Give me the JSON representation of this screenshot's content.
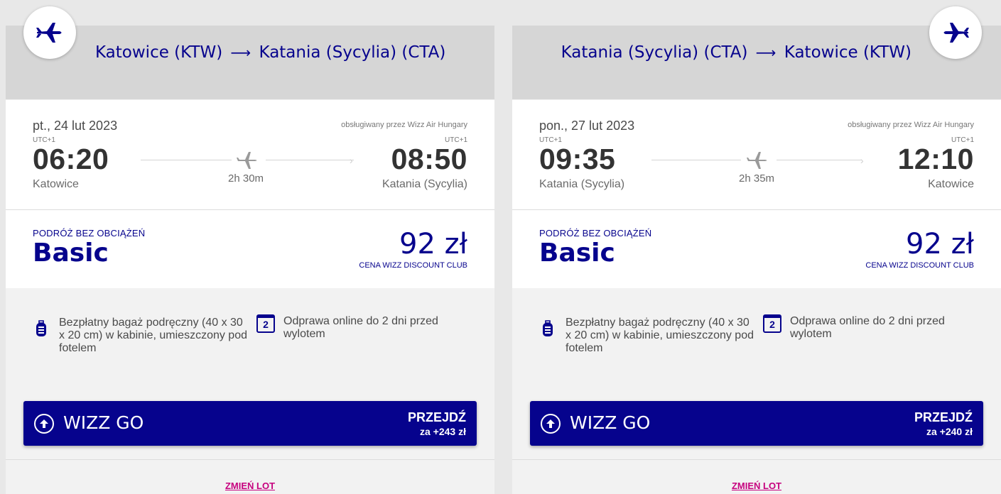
{
  "colors": {
    "brand_blue": "#06038d",
    "link_pink": "#c6007e"
  },
  "flights": [
    {
      "route_from": "Katowice (KTW)",
      "route_arrow": "⟶",
      "route_to": "Katania (Sycylia) (CTA)",
      "date": "pt., 24 lut 2023",
      "operated_by": "obsługiwany przez Wizz Air Hungary",
      "dep_utc": "UTC+1",
      "dep_time": "06:20",
      "dep_city": "Katowice",
      "arr_utc": "UTC+1",
      "arr_time": "08:50",
      "arr_city": "Katania (Sycylia)",
      "duration": "2h 30m",
      "fare_kicker": "PODRÓŻ BEZ OBCIĄŻEŃ",
      "fare_name": "Basic",
      "price": "92 zł",
      "price_note": "CENA WIZZ DISCOUNT CLUB",
      "benefit_bag": "Bezpłatny bagaż podręczny (40 x 30 x 20 cm) w kabinie, umieszczony pod fotelem",
      "benefit_checkin": "Odprawa online do 2 dni przed wylotem",
      "calendar_number": "2",
      "upgrade_label": "WIZZ GO",
      "upgrade_cta": "PRZEJDŹ",
      "upgrade_price": "za +243 zł",
      "change_link": "ZMIEŃ LOT"
    },
    {
      "route_from": "Katania (Sycylia) (CTA)",
      "route_arrow": "⟶",
      "route_to": "Katowice (KTW)",
      "date": "pon., 27 lut 2023",
      "operated_by": "obsługiwany przez Wizz Air Hungary",
      "dep_utc": "UTC+1",
      "dep_time": "09:35",
      "dep_city": "Katania (Sycylia)",
      "arr_utc": "UTC+1",
      "arr_time": "12:10",
      "arr_city": "Katowice",
      "duration": "2h 35m",
      "fare_kicker": "PODRÓŻ BEZ OBCIĄŻEŃ",
      "fare_name": "Basic",
      "price": "92 zł",
      "price_note": "CENA WIZZ DISCOUNT CLUB",
      "benefit_bag": "Bezpłatny bagaż podręczny (40 x 30 x 20 cm) w kabinie, umieszczony pod fotelem",
      "benefit_checkin": "Odprawa online do 2 dni przed wylotem",
      "calendar_number": "2",
      "upgrade_label": "WIZZ GO",
      "upgrade_cta": "PRZEJDŹ",
      "upgrade_price": "za +240 zł",
      "change_link": "ZMIEŃ LOT"
    }
  ]
}
